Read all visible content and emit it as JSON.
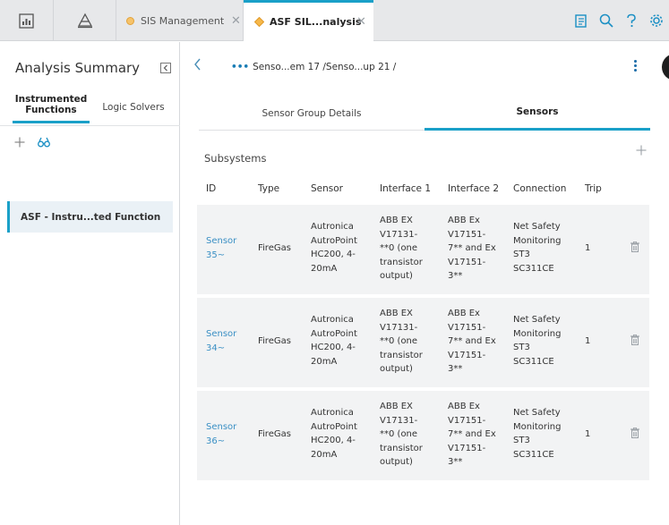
{
  "topbar": {
    "tabs": [
      {
        "label": "SIS Management",
        "active": false
      },
      {
        "label": "ASF SIL...nalysis",
        "active": true
      }
    ],
    "close_glyph": "✕"
  },
  "left": {
    "title": "Analysis Summary",
    "tabs": [
      {
        "label_line1": "Instrumented",
        "label_line2": "Functions",
        "active": true
      },
      {
        "label": "Logic Solvers",
        "active": false
      }
    ],
    "items": [
      "ASF - Instru...ted Function"
    ]
  },
  "main": {
    "breadcrumb": "Senso...em 17 /Senso...up 21 /",
    "tabs": [
      "Sensor Group Details",
      "Sensors"
    ],
    "section_title": "Subsystems",
    "columns": [
      "ID",
      "Type",
      "Sensor",
      "Interface 1",
      "Interface 2",
      "Connection",
      "Trip"
    ],
    "rows": [
      {
        "id": [
          "Sensor",
          "35~"
        ],
        "type": "FireGas",
        "sensor": [
          "Autronica",
          "AutroPoint",
          "HC200, 4-",
          "20mA"
        ],
        "interface1": [
          "ABB EX",
          "V17131-",
          "**0 (one",
          "transistor",
          "output)"
        ],
        "interface2": [
          "ABB Ex",
          "V17151-",
          "7** and Ex",
          "V17151-",
          "3**"
        ],
        "connection": [
          "Net Safety",
          "Monitoring",
          "ST3",
          "SC311CE"
        ],
        "trip": "1"
      },
      {
        "id": [
          "Sensor",
          "34~"
        ],
        "type": "FireGas",
        "sensor": [
          "Autronica",
          "AutroPoint",
          "HC200, 4-",
          "20mA"
        ],
        "interface1": [
          "ABB EX",
          "V17131-",
          "**0 (one",
          "transistor",
          "output)"
        ],
        "interface2": [
          "ABB Ex",
          "V17151-",
          "7** and Ex",
          "V17151-",
          "3**"
        ],
        "connection": [
          "Net Safety",
          "Monitoring",
          "ST3",
          "SC311CE"
        ],
        "trip": "1"
      },
      {
        "id": [
          "Sensor",
          "36~"
        ],
        "type": "FireGas",
        "sensor": [
          "Autronica",
          "AutroPoint",
          "HC200, 4-",
          "20mA"
        ],
        "interface1": [
          "ABB EX",
          "V17131-",
          "**0 (one",
          "transistor",
          "output)"
        ],
        "interface2": [
          "ABB Ex",
          "V17151-",
          "7** and Ex",
          "V17151-",
          "3**"
        ],
        "connection": [
          "Net Safety",
          "Monitoring",
          "ST3",
          "SC311CE"
        ],
        "trip": "1"
      }
    ]
  },
  "colors": {
    "accent": "#1aa0c8",
    "link": "#3a8fc4",
    "tab_bar": "#e7e8ea",
    "row_bg": "#f2f3f4"
  },
  "icons": [
    "dashboard-icon",
    "hierarchy-icon",
    "asset-dot-icon",
    "close-icon",
    "clipboard-icon",
    "search-icon",
    "help-icon",
    "settings-icon",
    "collapse-icon",
    "add-icon",
    "binoculars-icon",
    "back-icon",
    "more-icon",
    "trash-icon"
  ]
}
